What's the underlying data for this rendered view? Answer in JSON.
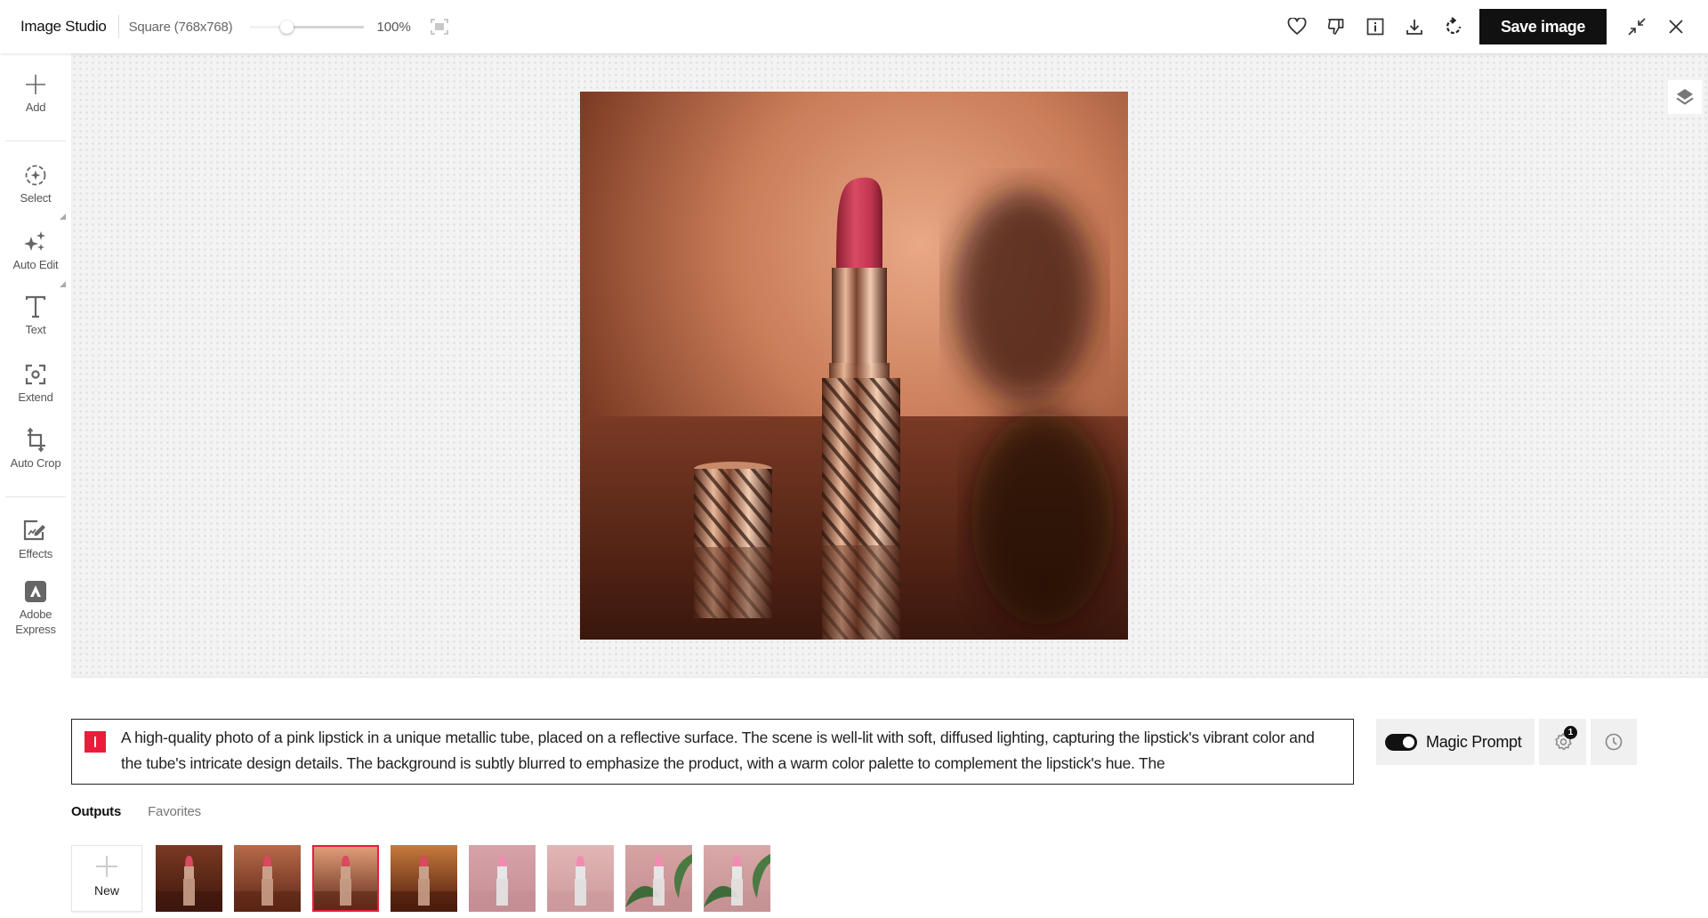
{
  "header": {
    "app_title": "Image Studio",
    "size_label": "Square (768x768)",
    "zoom_slider_fraction": 0.32,
    "zoom_value": "100%",
    "fit_icon": "fit-screen-icon",
    "actions": [
      {
        "name": "favorite",
        "icon": "heart-icon"
      },
      {
        "name": "dislike",
        "icon": "thumbs-down-icon"
      },
      {
        "name": "info",
        "icon": "info-icon"
      },
      {
        "name": "download",
        "icon": "download-icon"
      },
      {
        "name": "regenerate",
        "icon": "refresh-icon"
      }
    ],
    "save_label": "Save image",
    "minimize_icon": "minimize-icon",
    "close_icon": "close-icon"
  },
  "sidebar": {
    "items": [
      {
        "label": "Add",
        "icon": "plus-icon"
      },
      {
        "label": "Select",
        "icon": "select-icon"
      },
      {
        "label": "Auto Edit",
        "icon": "sparkles-icon"
      },
      {
        "label": "Text",
        "icon": "text-icon"
      },
      {
        "label": "Extend",
        "icon": "extend-icon"
      },
      {
        "label": "Auto Crop",
        "icon": "crop-icon"
      },
      {
        "label": "Effects",
        "icon": "effects-icon"
      },
      {
        "label": "Adobe Express",
        "icon": "adobe-express-icon"
      }
    ]
  },
  "canvas": {
    "image_alt": "Pink lipstick in rose-gold metallic swirl tube with cap on reflective surface",
    "layers_icon": "layers-icon"
  },
  "prompt": {
    "text": "A high-quality photo of a pink lipstick in a unique metallic tube, placed on a reflective surface. The scene is well-lit with soft, diffused lighting, capturing the lipstick's vibrant color and the tube's intricate design details. The background is subtly blurred to emphasize the product, with a warm color palette to complement the lipstick's hue. The",
    "magic_prompt_label": "Magic Prompt",
    "magic_prompt_on": true,
    "settings_badge": "1",
    "accent_color": "#eb1c3b"
  },
  "outputs": {
    "tabs": [
      {
        "label": "Outputs",
        "active": true
      },
      {
        "label": "Favorites",
        "active": false
      }
    ],
    "new_label": "New",
    "selected_index": 2,
    "thumbnails": [
      {
        "desc": "lipstick on dark brown backdrop"
      },
      {
        "desc": "lipstick with cap on terracotta backdrop"
      },
      {
        "desc": "lipstick with cap, warm peach backdrop (current)"
      },
      {
        "desc": "lipstick with glowing amber backdrop"
      },
      {
        "desc": "light pink lipstick on pink backdrop"
      },
      {
        "desc": "light pink lipstick on blush backdrop"
      },
      {
        "desc": "light pink lipstick with green leaves"
      },
      {
        "desc": "light pink lipstick with palm frond"
      }
    ]
  }
}
